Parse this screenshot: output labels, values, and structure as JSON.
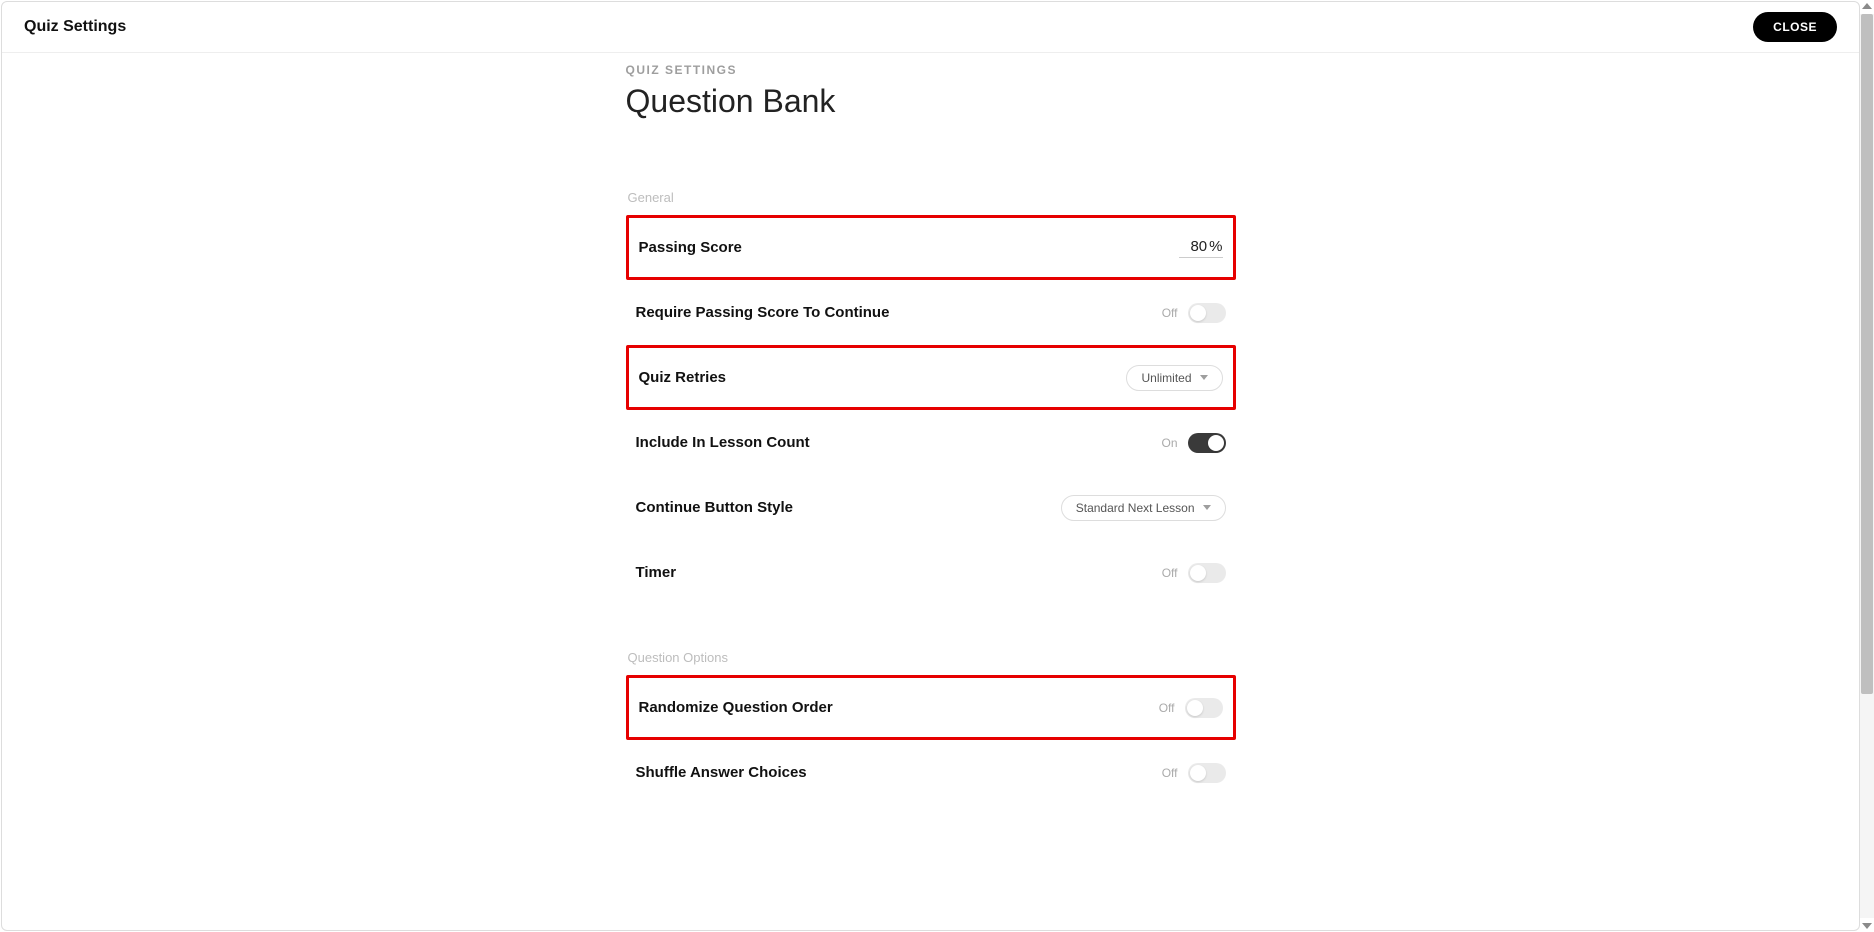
{
  "header": {
    "title": "Quiz Settings",
    "close_label": "CLOSE"
  },
  "eyebrow": "QUIZ SETTINGS",
  "page_title": "Question Bank",
  "sections": {
    "general": {
      "label": "General",
      "passing_score": {
        "label": "Passing Score",
        "value": "80",
        "unit": "%"
      },
      "require_passing": {
        "label": "Require Passing Score To Continue",
        "status": "Off",
        "on": false
      },
      "quiz_retries": {
        "label": "Quiz Retries",
        "value": "Unlimited"
      },
      "include_lesson": {
        "label": "Include In Lesson Count",
        "status": "On",
        "on": true
      },
      "continue_style": {
        "label": "Continue Button Style",
        "value": "Standard Next Lesson"
      },
      "timer": {
        "label": "Timer",
        "status": "Off",
        "on": false
      }
    },
    "question_options": {
      "label": "Question Options",
      "randomize": {
        "label": "Randomize Question Order",
        "status": "Off",
        "on": false
      },
      "shuffle": {
        "label": "Shuffle Answer Choices",
        "status": "Off",
        "on": false
      }
    }
  }
}
